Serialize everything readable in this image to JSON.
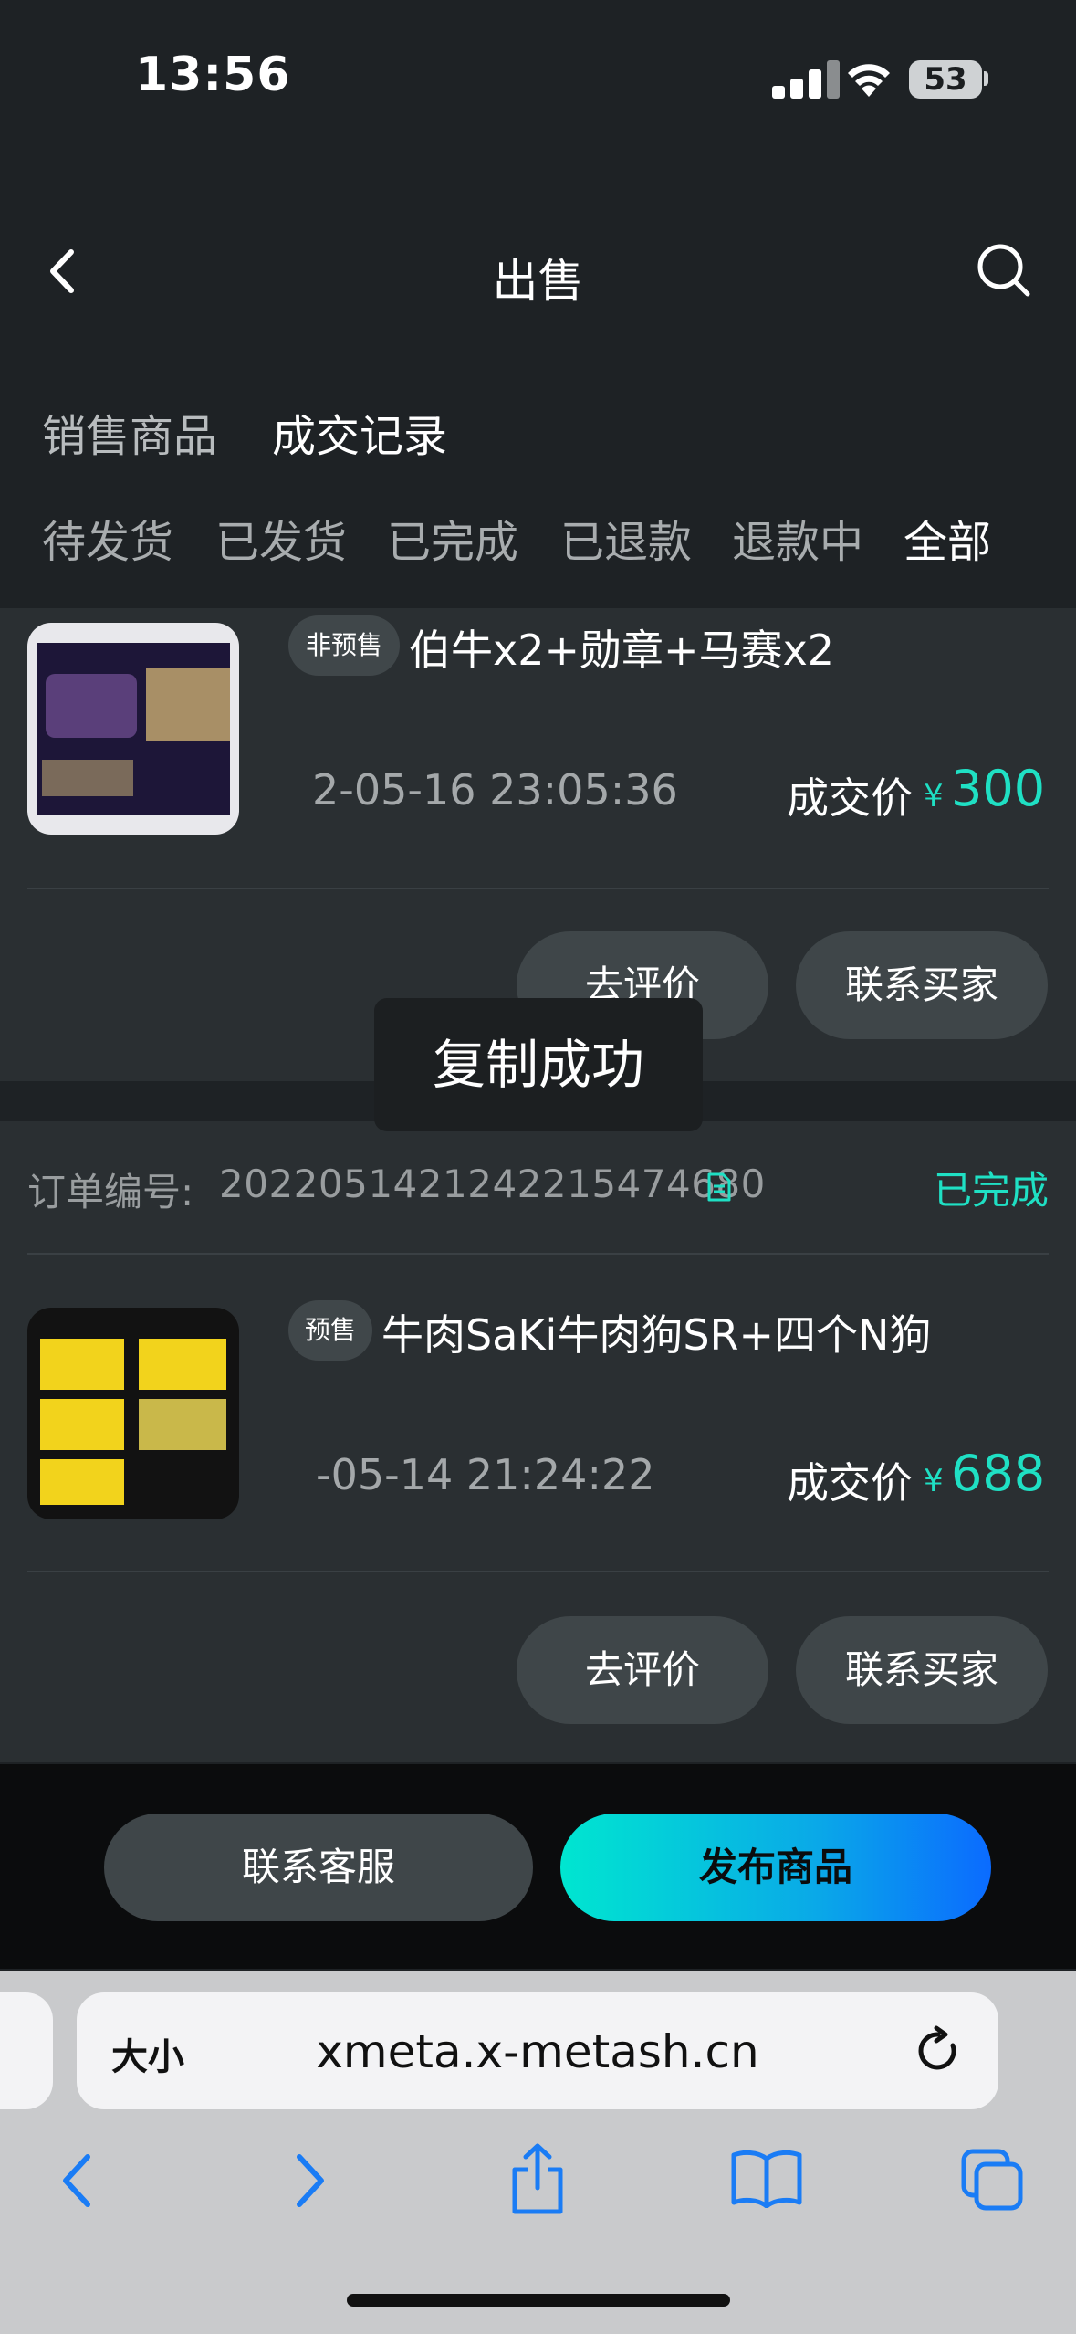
{
  "status_bar": {
    "time": "13:56",
    "battery": "53"
  },
  "nav": {
    "title": "出售"
  },
  "main_tabs": [
    "销售商品",
    "成交记录"
  ],
  "sub_tabs": [
    "待发货",
    "已发货",
    "已完成",
    "已退款",
    "退款中",
    "全部"
  ],
  "orders": [
    {
      "tag": "非预售",
      "name": "伯牛x2+勋章+马赛x2",
      "time": "2-05-16 23:05:36",
      "price_label": "成交价",
      "currency": "¥",
      "price": "300",
      "buttons": [
        "去评价",
        "联系买家"
      ]
    },
    {
      "order_label": "订单编号:",
      "order_number": "2022051421242215474680",
      "status": "已完成",
      "tag": "预售",
      "name": "牛肉SaKi牛肉狗SR+四个N狗",
      "time": "-05-14 21:24:22",
      "price_label": "成交价",
      "currency": "¥",
      "price": "688",
      "buttons": [
        "去评价",
        "联系买家"
      ]
    }
  ],
  "toast": "复制成功",
  "bottom_actions": {
    "service": "联系客服",
    "publish": "发布商品"
  },
  "browser": {
    "text_size": "大小",
    "url": "xmeta.x-metash.cn"
  },
  "colors": {
    "accent": "#1fe0c4",
    "background": "#1e2225",
    "card": "#2a2f32"
  }
}
